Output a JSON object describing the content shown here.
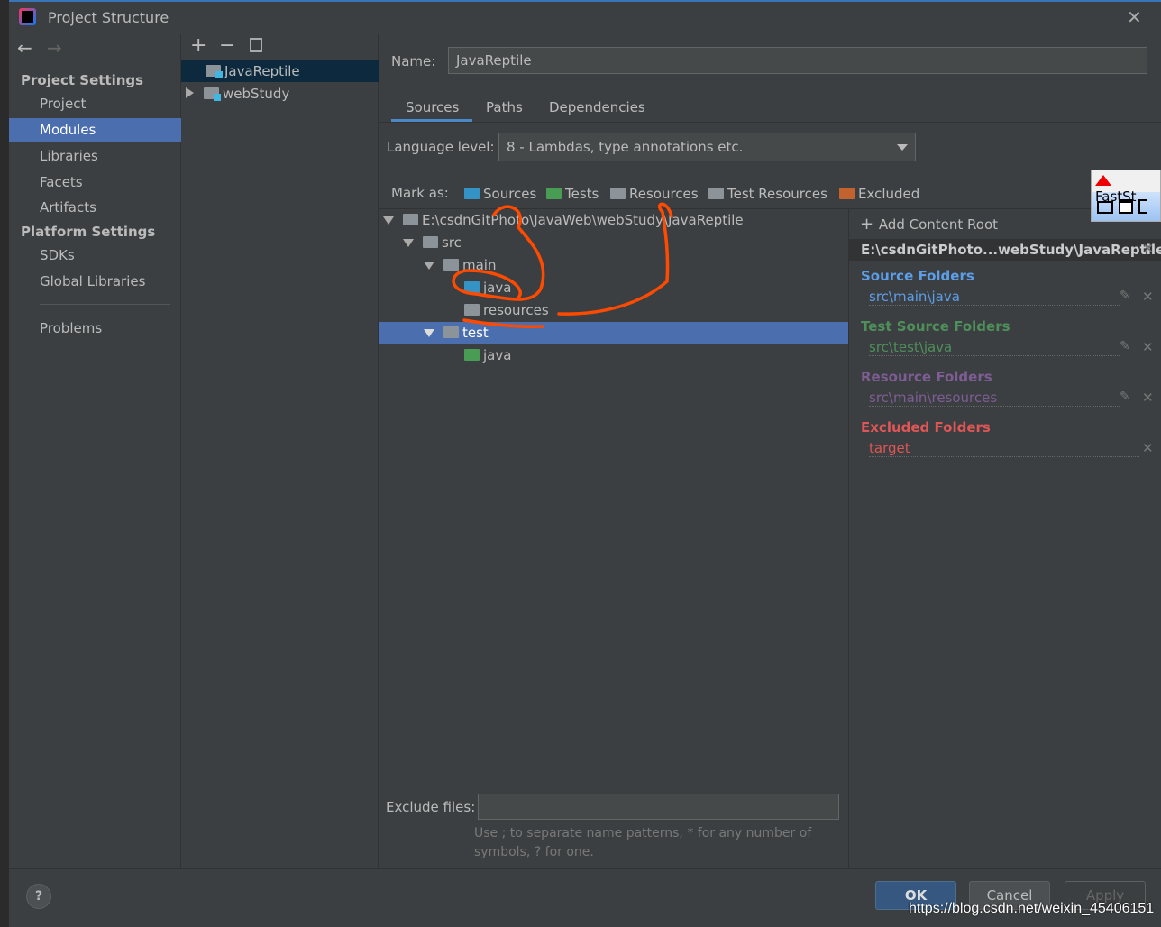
{
  "window": {
    "title": "Project Structure"
  },
  "sidebar": {
    "project_settings_header": "Project Settings",
    "platform_settings_header": "Platform Settings",
    "items": [
      {
        "label": "Project"
      },
      {
        "label": "Modules"
      },
      {
        "label": "Libraries"
      },
      {
        "label": "Facets"
      },
      {
        "label": "Artifacts"
      }
    ],
    "platform_items": [
      {
        "label": "SDKs"
      },
      {
        "label": "Global Libraries"
      }
    ],
    "problems": "Problems"
  },
  "modules": {
    "items": [
      {
        "label": "JavaReptile",
        "selected": true
      },
      {
        "label": "webStudy",
        "selected": false
      }
    ]
  },
  "main": {
    "name_label": "Name:",
    "name_value": "JavaReptile",
    "tabs": [
      {
        "label": "Sources",
        "active": true
      },
      {
        "label": "Paths"
      },
      {
        "label": "Dependencies"
      }
    ],
    "language_level_label": "Language level:",
    "language_level_value": "8 - Lambdas, type annotations etc.",
    "mark_as_label": "Mark as:",
    "mark_as": [
      {
        "label": "Sources",
        "color": "#3592c4"
      },
      {
        "label": "Tests",
        "color": "#499c54"
      },
      {
        "label": "Resources",
        "color": "#8c9399"
      },
      {
        "label": "Test Resources",
        "color": "#8c9399"
      },
      {
        "label": "Excluded",
        "color": "#c2622f"
      }
    ],
    "tree": [
      {
        "label": "E:\\csdnGitPhoto\\JavaWeb\\webStudy\\JavaReptile"
      },
      {
        "label": "src"
      },
      {
        "label": "main"
      },
      {
        "label": "java"
      },
      {
        "label": "resources"
      },
      {
        "label": "test",
        "selected": true
      },
      {
        "label": "java"
      }
    ],
    "exclude_files_label": "Exclude files:",
    "exclude_files_value": "",
    "exclude_hint_line1": "Use ; to separate name patterns, * for any number of",
    "exclude_hint_line2": "symbols, ? for one."
  },
  "content_root": {
    "add_label": "Add Content Root",
    "path": "E:\\csdnGitPhoto...webStudy\\JavaReptile",
    "groups": [
      {
        "title": "Source Folders",
        "color": "#5c9ee8",
        "entries": [
          "src\\main\\java"
        ]
      },
      {
        "title": "Test Source Folders",
        "color": "#4e8f5a",
        "entries": [
          "src\\test\\java"
        ]
      },
      {
        "title": "Resource Folders",
        "color": "#7d5d94",
        "entries": [
          "src\\main\\resources"
        ]
      },
      {
        "title": "Excluded Folders",
        "color": "#e05555",
        "entries": [
          "target"
        ]
      }
    ]
  },
  "overlay": {
    "faststone_label": "FastSt"
  },
  "footer": {
    "help": "?",
    "ok": "OK",
    "cancel": "Cancel",
    "apply": "Apply"
  },
  "watermark": "https://blog.csdn.net/weixin_45406151",
  "colors": {
    "selection": "#4b6eaf",
    "annotation": "#ff4a00"
  }
}
